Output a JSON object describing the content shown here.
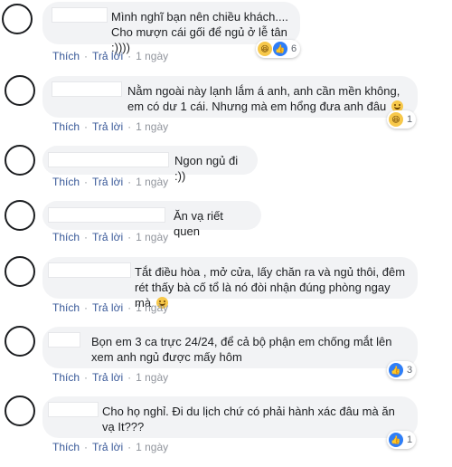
{
  "actions": {
    "like": "Thích",
    "reply": "Trả lời",
    "separator": "·"
  },
  "comments": [
    {
      "text": "Mình nghĩ bạn nên chiều khách....\nCho mượn cái gối để ngủ ở lễ tân :))))",
      "time": "1 ngày",
      "reaction_count": "6",
      "reactions": [
        "haha-icon",
        "like-icon"
      ]
    },
    {
      "text": "Nằm ngoài này lạnh lắm á anh, anh cần mền không,\nem có dư 1 cái. Nhưng mà em hổng đưa anh đâu",
      "time": "1 ngày",
      "reaction_count": "1",
      "reactions": [
        "haha-icon"
      ]
    },
    {
      "text": "Ngon ngủ đi :))",
      "time": "1 ngày"
    },
    {
      "text": "Ăn vạ riết quen",
      "time": "1 ngày"
    },
    {
      "text": "Tắt điều hòa , mở cửa, lấy chăn ra và ngủ thôi, đêm\nrét thấy bà cố tổ là nó đòi nhận đúng phòng ngay mà",
      "time": "1 ngày"
    },
    {
      "text": "Bọn em 3 ca trực 24/24, để cả bộ phận em chống mắt lên\nxem anh ngủ được mấy hôm",
      "time": "1 ngày",
      "reaction_count": "3",
      "reactions": [
        "like-icon"
      ]
    },
    {
      "text": "Cho họ nghỉ. Đi du lịch chứ có phải hành xác đâu mà ăn\nvạ It???",
      "time": "1 ngày",
      "reaction_count": "1",
      "reactions": [
        "like-icon"
      ]
    }
  ]
}
